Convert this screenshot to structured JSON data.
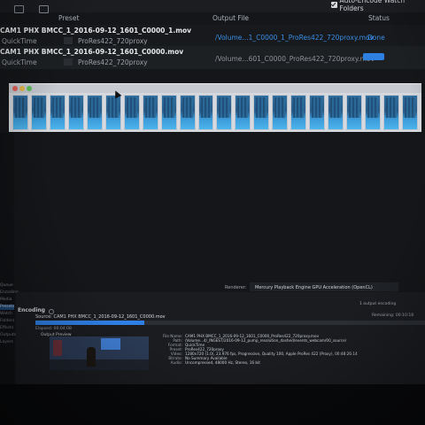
{
  "header": {
    "auto_encode_label": "Auto-Encode Watch Folders",
    "col_preset": "Preset",
    "col_output": "Output File",
    "col_status": "Status"
  },
  "queue": [
    {
      "source": "CAM1 PHX BMCC_1_2016-09-12_1601_C0000_1.mov",
      "format": "QuickTime",
      "preset": "ProRes422_720proxy",
      "output": "/Volume...1_C0000_1_ProRes422_720proxy.mov",
      "status": "Done"
    },
    {
      "source": "CAM1 PHX BMCC_1_2016-09-12_1601_C0000.mov",
      "format": "QuickTime",
      "preset": "ProRes422_720proxy",
      "output": "/Volume...601_C0000_ProRes422_720proxy.mov",
      "status": ""
    }
  ],
  "renderer": {
    "label": "Renderer:",
    "value": "Mercury Playback Engine GPU Acceleration (OpenCL)"
  },
  "encoding": {
    "title": "Encoding",
    "count": "1 output encoding",
    "source": "Source: CAM1 PHX BMCC_1_2016-09-12_1601_C0000.mov",
    "remaining": "Remaining: 00:10:18",
    "elapsed": "Elapsed: 00:04:08",
    "output_preview": "Output Preview",
    "progress": 0.28,
    "meta": [
      {
        "k": "File Name:",
        "v": "CAM1 PHX BMCC_1_2016-09-12_1601_C0000_ProRes422_720proxy.mov"
      },
      {
        "k": "Path:",
        "v": "/Volume...4/_INGEST/2016-09-12_pump_resolution_dashed/events_webcam/00_source/"
      },
      {
        "k": "Format:",
        "v": "QuickTime"
      },
      {
        "k": "Preset:",
        "v": "ProRes422_720proxy"
      },
      {
        "k": "Video:",
        "v": "1280x720 (1.0), 23.976 fps, Progressive, Quality 100, Apple ProRes 422 (Proxy), 00:48:26:14"
      },
      {
        "k": "Bitrate:",
        "v": "No Summary Available"
      },
      {
        "k": "Audio:",
        "v": "Uncompressed, 48000 Hz, Stereo, 16 bit"
      }
    ]
  },
  "sidebar": {
    "items": [
      "Queue",
      "Encoding",
      "Media",
      "Presets",
      "Watch",
      "Folders",
      "Effects",
      "Outputs",
      "Layers"
    ]
  },
  "colors": {
    "accent": "#2f80e6",
    "link": "#3a8ee6"
  }
}
